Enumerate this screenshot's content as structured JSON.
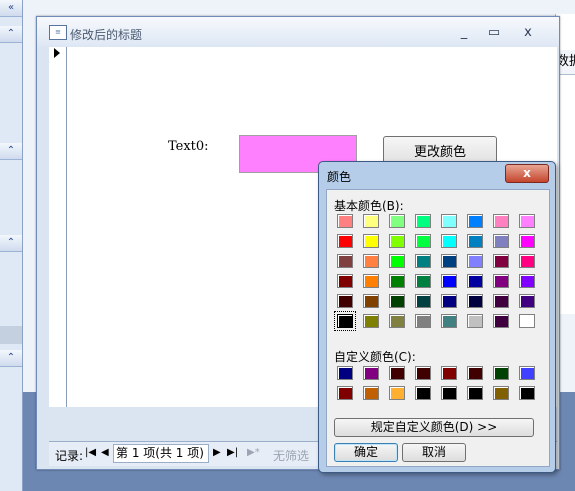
{
  "nav_pane": {
    "collapse_glyph": "«",
    "section_glyph": "⌃"
  },
  "background": {
    "header_text": "数据"
  },
  "form": {
    "title": "修改后的标题",
    "window_controls": {
      "minimize": "_",
      "maximize": "▭",
      "close": "x"
    },
    "text0_label": "Text0:",
    "text0_color": "#ff80ff",
    "change_color_button": "更改颜色"
  },
  "record_nav": {
    "label": "记录:",
    "first": "|◀",
    "prev": "◀",
    "position": "第 1 项(共 1 项)",
    "next": "▶",
    "last": "▶|",
    "new": "▶*",
    "filter_text": "无筛选"
  },
  "color_dialog": {
    "title": "颜色",
    "close": "x",
    "basic_colors_label": "基本颜色(B):",
    "custom_colors_label": "自定义颜色(C):",
    "define_custom_button": "规定自定义颜色(D) >>",
    "ok_button": "确定",
    "cancel_button": "取消",
    "selected_basic_index": 40,
    "basic_colors": [
      "#ff8080",
      "#ffff80",
      "#80ff80",
      "#00ff80",
      "#80ffff",
      "#0080ff",
      "#ff80c0",
      "#ff80ff",
      "#ff0000",
      "#ffff00",
      "#80ff00",
      "#00ff40",
      "#00ffff",
      "#0080c0",
      "#8080c0",
      "#ff00ff",
      "#804040",
      "#ff8040",
      "#00ff00",
      "#008080",
      "#004080",
      "#8080ff",
      "#800040",
      "#ff0080",
      "#800000",
      "#ff8000",
      "#008000",
      "#008040",
      "#0000ff",
      "#0000a0",
      "#800080",
      "#8000ff",
      "#400000",
      "#804000",
      "#004000",
      "#004040",
      "#000080",
      "#000040",
      "#400040",
      "#400080",
      "#000000",
      "#808000",
      "#808040",
      "#808080",
      "#408080",
      "#c0c0c0",
      "#400040",
      "#ffffff"
    ],
    "custom_colors": [
      "#000080",
      "#800080",
      "#400000",
      "#400000",
      "#800000",
      "#400000",
      "#004000",
      "#4040ff",
      "#800000",
      "#c06000",
      "#ffb030",
      "#000000",
      "#000000",
      "#000000",
      "#806000",
      "#000000"
    ]
  }
}
